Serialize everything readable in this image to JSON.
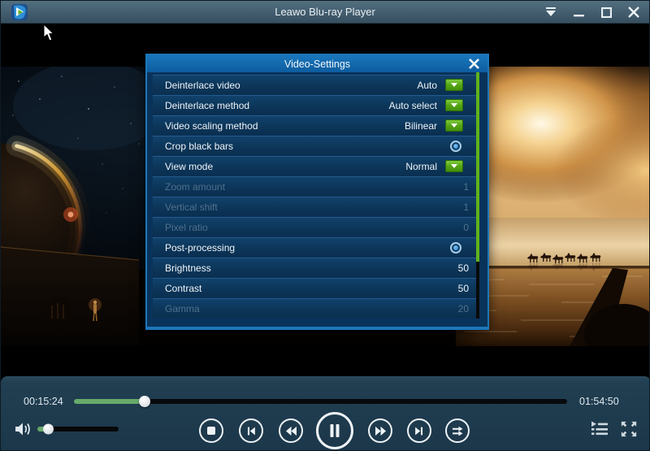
{
  "titlebar": {
    "title": "Leawo Blu-ray Player",
    "icons": [
      "app-logo",
      "menu-chevron",
      "minimize",
      "maximize",
      "close"
    ]
  },
  "dialog": {
    "title": "Video-Settings",
    "close_icon": "close",
    "rows": [
      {
        "label": "Deinterlace video",
        "value": "Auto",
        "control": "dropdown",
        "disabled": false
      },
      {
        "label": "Deinterlace method",
        "value": "Auto select",
        "control": "dropdown",
        "disabled": false
      },
      {
        "label": "Video scaling method",
        "value": "Bilinear",
        "control": "dropdown",
        "disabled": false
      },
      {
        "label": "Crop black bars",
        "value": "",
        "control": "toggle",
        "disabled": false
      },
      {
        "label": "View mode",
        "value": "Normal",
        "control": "dropdown",
        "disabled": false
      },
      {
        "label": "Zoom amount",
        "value": "1",
        "control": "value",
        "disabled": true
      },
      {
        "label": "Vertical shift",
        "value": "1",
        "control": "value",
        "disabled": true
      },
      {
        "label": "Pixel ratio",
        "value": "0",
        "control": "value",
        "disabled": true
      },
      {
        "label": "Post-processing",
        "value": "",
        "control": "toggle",
        "disabled": false
      },
      {
        "label": "Brightness",
        "value": "50",
        "control": "value",
        "disabled": false
      },
      {
        "label": "Contrast",
        "value": "50",
        "control": "value",
        "disabled": false
      },
      {
        "label": "Gamma",
        "value": "20",
        "control": "value",
        "disabled": true
      }
    ],
    "scrollbar": {
      "thumb_percent": 77
    }
  },
  "player": {
    "elapsed": "00:15:24",
    "duration": "01:54:50",
    "progress_percent": 14.3,
    "volume_percent": 13,
    "transport": [
      "stop",
      "previous",
      "rewind",
      "pause",
      "fast-forward",
      "next",
      "play-order"
    ],
    "bottom_right_icons": [
      "playlist",
      "fullscreen"
    ]
  },
  "colors": {
    "titlebar": "#435d6f",
    "dialog_header": "#1068ac",
    "dialog_body": "#09335a",
    "row": "#0c3558",
    "accent_green": "#55a614",
    "scroll_green": "#5fb21c",
    "progress_green": "#67aa6b",
    "controlbar": "#1e3a4d",
    "disabled_text": "#4f708c"
  }
}
